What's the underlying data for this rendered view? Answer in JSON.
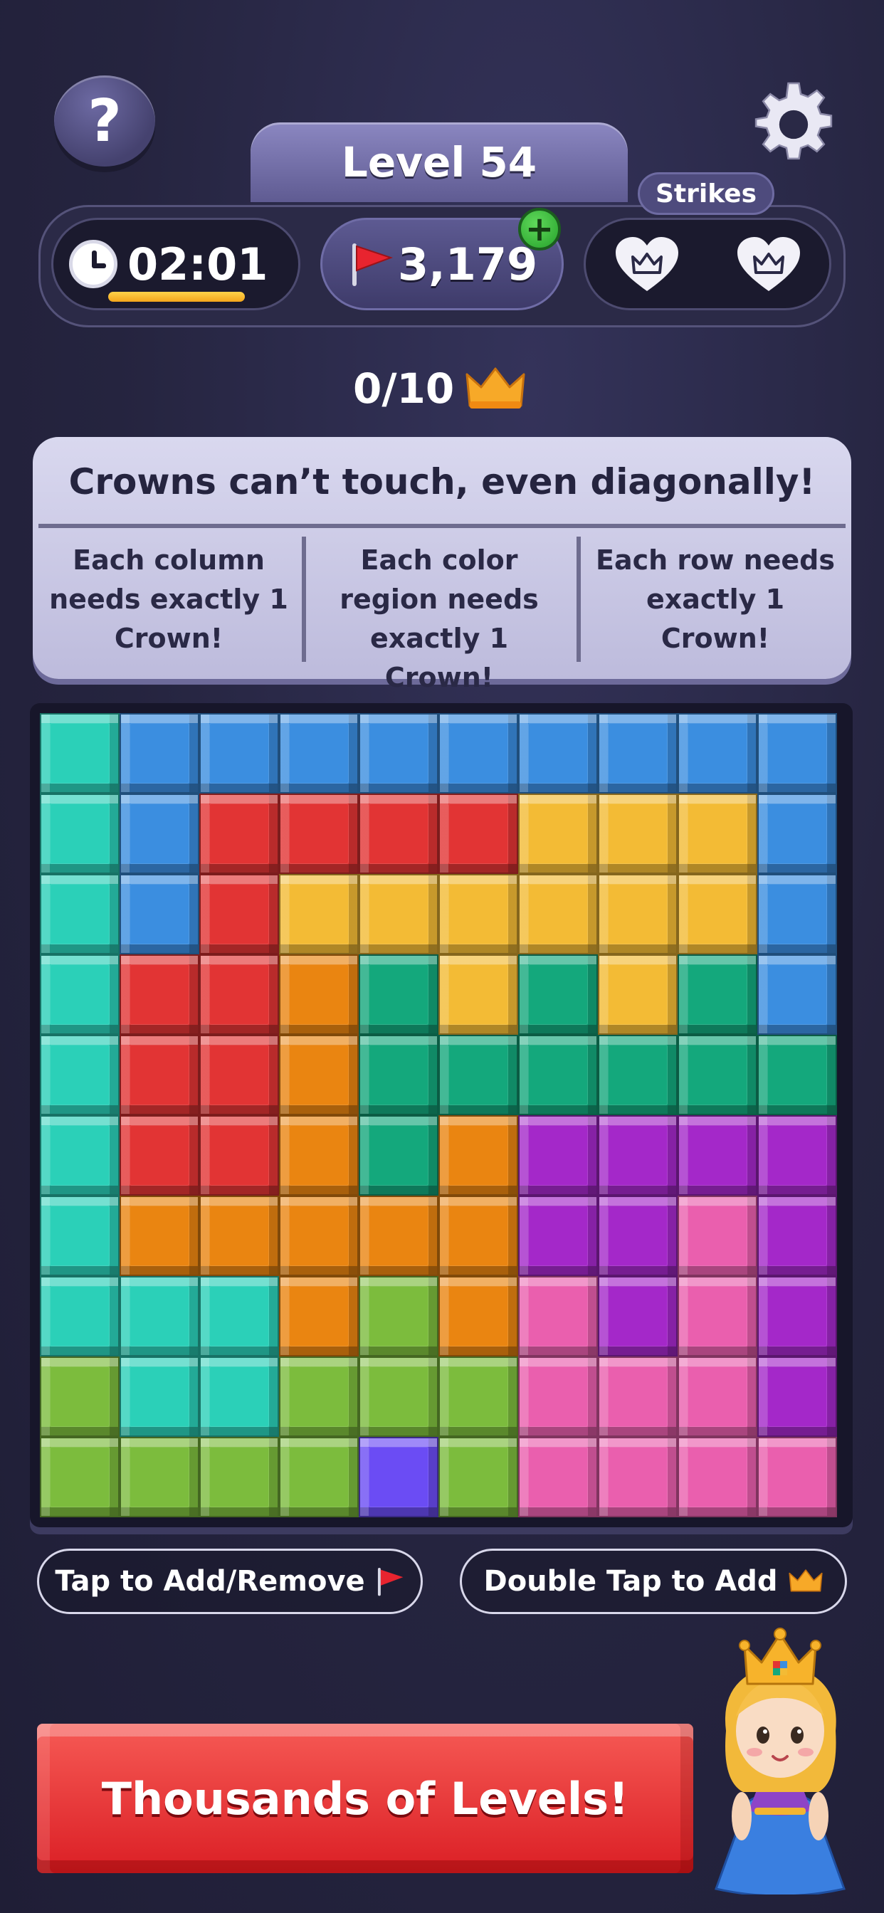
{
  "header": {
    "help_label": "?",
    "level_label": "Level 54",
    "strikes_label": "Strikes",
    "timer": "02:01",
    "score": "3,179",
    "add_label": "+",
    "strikes_remaining": 2
  },
  "progress": {
    "crowns_text": "0/10"
  },
  "rules": {
    "title": "Crowns can’t touch, even diagonally!",
    "col1": "Each column needs exactly 1 Crown!",
    "col2": "Each color region needs exactly 1 Crown!",
    "col3": "Each row needs exactly 1 Crown!"
  },
  "board": {
    "colors": {
      "T": "#2bd0b8",
      "B": "#3b8ee0",
      "R": "#e23434",
      "Y": "#f3bb35",
      "O": "#ea8511",
      "G": "#14a87c",
      "P": "#a428c9",
      "K": "#ea5fae",
      "L": "#7cbc3d",
      "V": "#6b4cf4"
    },
    "rows": [
      "TBBBBBBBBB",
      "TBRRRRYYYB",
      "TBRYYYYYYB",
      "TRROGYGYGB",
      "TRROGGGGGG",
      "TRROGOPPPP",
      "TOOOOOPPKP",
      "TTTOLOKPKP",
      "LTTLLLKKKP",
      "LLLLVLKKKK"
    ]
  },
  "hints": {
    "left": "Tap to Add/Remove",
    "right": "Double Tap to Add"
  },
  "cta": {
    "label": "Thousands of Levels!"
  }
}
